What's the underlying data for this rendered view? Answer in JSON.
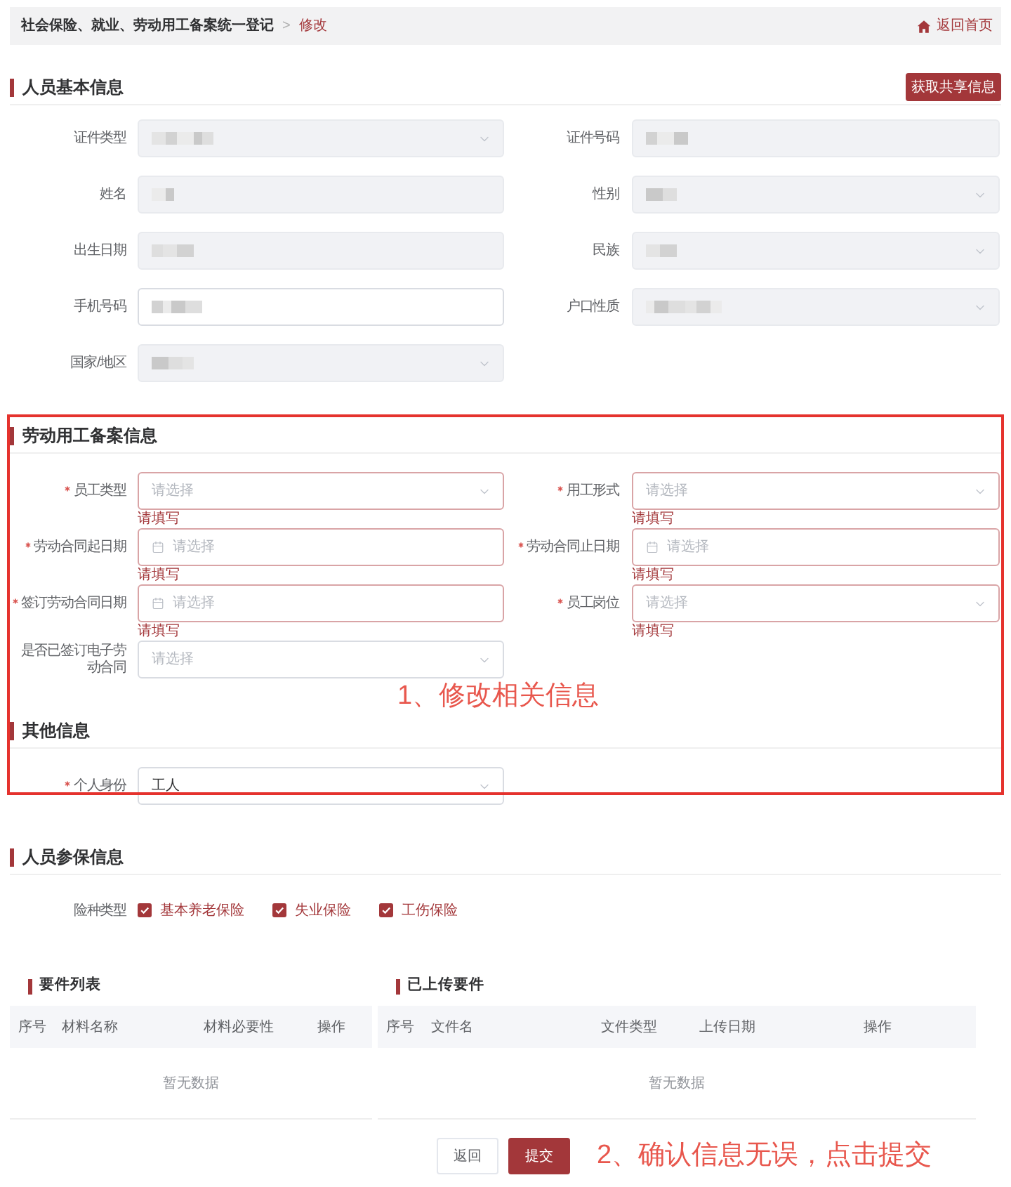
{
  "breadcrumb": {
    "items": [
      {
        "label": "社会保险、就业、劳动用工备案统一登记",
        "current": false
      },
      {
        "label": "修改",
        "current": true
      }
    ],
    "separator": ">",
    "home_link": "返回首页"
  },
  "basic_info": {
    "title": "人员基本信息",
    "action_button": "获取共享信息",
    "fields": [
      {
        "label": "证件类型",
        "kind": "select",
        "disabled": true,
        "redacted": true
      },
      {
        "label": "证件号码",
        "kind": "input",
        "disabled": true,
        "redacted": true
      },
      {
        "label": "姓名",
        "kind": "input",
        "disabled": true,
        "redacted": true
      },
      {
        "label": "性别",
        "kind": "select",
        "disabled": true,
        "redacted": true
      },
      {
        "label": "出生日期",
        "kind": "input",
        "disabled": true,
        "redacted": true
      },
      {
        "label": "民族",
        "kind": "select",
        "disabled": true,
        "redacted": true
      },
      {
        "label": "手机号码",
        "kind": "input",
        "disabled": false,
        "redacted": true
      },
      {
        "label": "户口性质",
        "kind": "select",
        "disabled": true,
        "redacted": true
      },
      {
        "label": "国家/地区",
        "kind": "select",
        "disabled": true,
        "redacted": true
      }
    ]
  },
  "filing_info": {
    "title": "劳动用工备案信息",
    "fields": [
      {
        "label": "员工类型",
        "kind": "select",
        "required": true,
        "placeholder": "请选择",
        "error": "请填写"
      },
      {
        "label": "用工形式",
        "kind": "select",
        "required": true,
        "placeholder": "请选择",
        "error": "请填写"
      },
      {
        "label": "劳动合同起日期",
        "kind": "date",
        "required": true,
        "placeholder": "请选择",
        "error": "请填写"
      },
      {
        "label": "劳动合同止日期",
        "kind": "date",
        "required": true,
        "placeholder": "请选择",
        "error": "请填写"
      },
      {
        "label": "签订劳动合同日期",
        "kind": "date",
        "required": true,
        "placeholder": "请选择",
        "error": "请填写"
      },
      {
        "label": "员工岗位",
        "kind": "select",
        "required": true,
        "placeholder": "请选择",
        "error": "请填写"
      },
      {
        "label": "是否已签订电子劳动合同",
        "kind": "select",
        "required": false,
        "placeholder": "请选择"
      }
    ],
    "annotation": "1、修改相关信息"
  },
  "other_info": {
    "title": "其他信息",
    "fields": [
      {
        "label": "个人身份",
        "kind": "select",
        "required": true,
        "value": "工人"
      }
    ]
  },
  "insurance_info": {
    "title": "人员参保信息",
    "label": "险种类型",
    "types": [
      {
        "label": "基本养老保险",
        "checked": true
      },
      {
        "label": "失业保险",
        "checked": true
      },
      {
        "label": "工伤保险",
        "checked": true
      }
    ]
  },
  "required_documents": {
    "title": "要件列表",
    "columns": [
      "序号",
      "材料名称",
      "材料必要性",
      "操作"
    ],
    "empty_text": "暂无数据"
  },
  "uploaded_documents": {
    "title": "已上传要件",
    "columns": [
      "序号",
      "文件名",
      "文件类型",
      "上传日期",
      "操作"
    ],
    "empty_text": "暂无数据"
  },
  "footer": {
    "buttons": [
      {
        "label": "返回",
        "kind": "secondary"
      },
      {
        "label": "提交",
        "kind": "primary"
      }
    ],
    "annotation": "2、确认信息无误，点击提交"
  }
}
